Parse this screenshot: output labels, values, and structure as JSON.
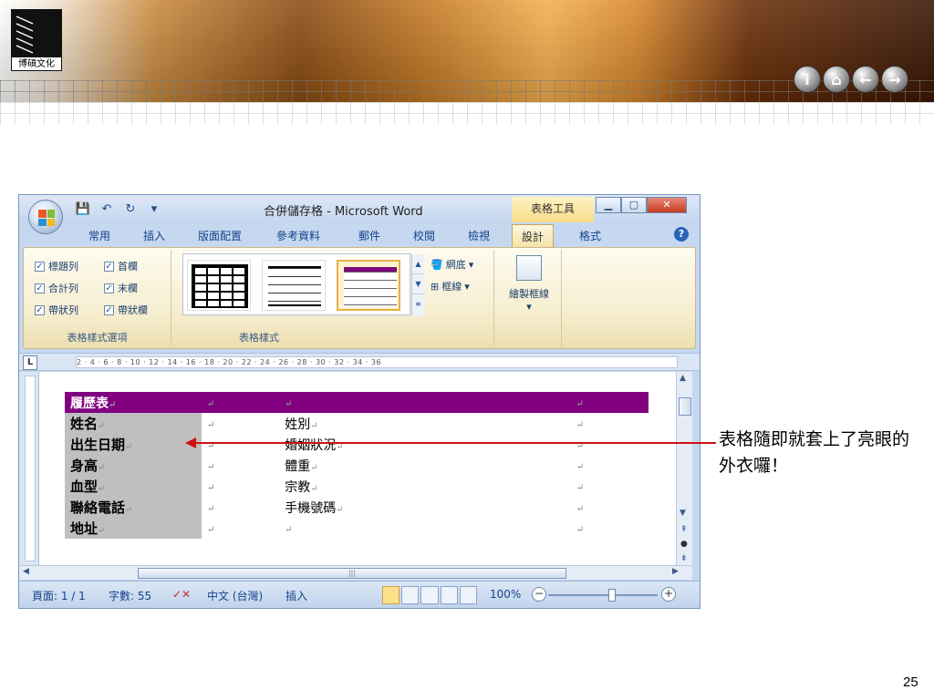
{
  "slide": {
    "logo_text": "博碩文化",
    "nav_buttons": [
      {
        "icon": "info-icon",
        "glyph": "i"
      },
      {
        "icon": "home-icon",
        "glyph": "⌂"
      },
      {
        "icon": "back-arrow-icon",
        "glyph": "←"
      },
      {
        "icon": "forward-arrow-icon",
        "glyph": "→"
      }
    ],
    "callout_text": "表格隨即就套上了亮眼的外衣囉！",
    "page_number": "25",
    "annotation_color": "#d01010"
  },
  "word": {
    "title": "合併儲存格 - Microsoft Word",
    "context_tab": "表格工具",
    "tabs": [
      "常用",
      "插入",
      "版面配置",
      "參考資料",
      "郵件",
      "校閱",
      "檢視",
      "設計",
      "格式"
    ],
    "active_tab": "設計",
    "style_options": {
      "items": [
        "標題列",
        "首欄",
        "合計列",
        "末欄",
        "帶狀列",
        "帶狀欄"
      ],
      "group_label": "表格樣式選項"
    },
    "table_styles": {
      "group_label": "表格樣式",
      "shading_label": "網底",
      "borders_label": "框線"
    },
    "draw_borders": {
      "label": "繪製框線"
    },
    "ruler_text": "2 · 4 · 6 · 8 · 10 · 12 · 14 · 16 · 18 · 20 · 22 · 24 · 26 · 28 · 30 · 32 · 34 · 36",
    "resume_table": {
      "header": "履歷表",
      "rows": [
        {
          "label": "姓名",
          "mid_label": "姓別"
        },
        {
          "label": "出生日期",
          "mid_label": "婚姻狀況"
        },
        {
          "label": "身高",
          "mid_label": "體重"
        },
        {
          "label": "血型",
          "mid_label": "宗教"
        },
        {
          "label": "聯絡電話",
          "mid_label": "手機號碼"
        },
        {
          "label": "地址",
          "mid_label": ""
        }
      ],
      "header_color": "#800080",
      "label_color": "#bfbfbf"
    },
    "status": {
      "page": "頁面: 1 / 1",
      "words": "字數: 55",
      "language": "中文 (台灣)",
      "mode": "插入",
      "zoom": "100%"
    }
  }
}
